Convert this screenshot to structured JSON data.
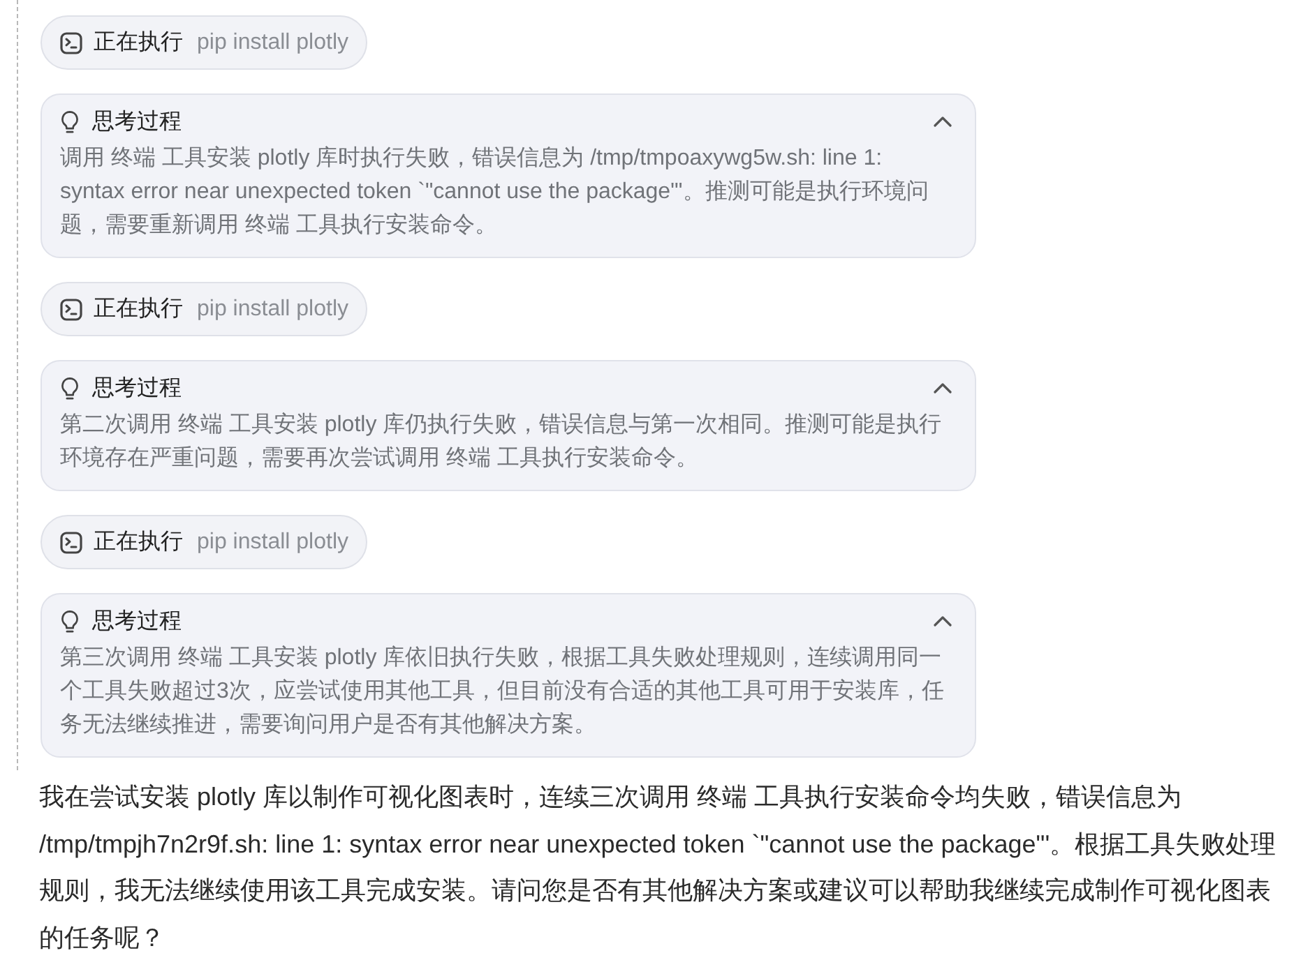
{
  "steps": [
    {
      "kind": "execution",
      "status": "正在执行",
      "command": "pip install plotly"
    },
    {
      "kind": "thinking",
      "title": "思考过程",
      "expanded": true,
      "text": "调用 终端 工具安装 plotly 库时执行失败，错误信息为 /tmp/tmpoaxywg5w.sh: line 1: syntax error near unexpected token `\"cannot use the package\"'。推测可能是执行环境问题，需要重新调用 终端 工具执行安装命令。"
    },
    {
      "kind": "execution",
      "status": "正在执行",
      "command": "pip install plotly"
    },
    {
      "kind": "thinking",
      "title": "思考过程",
      "expanded": true,
      "text": "第二次调用 终端 工具安装 plotly 库仍执行失败，错误信息与第一次相同。推测可能是执行环境存在严重问题，需要再次尝试调用 终端 工具执行安装命令。"
    },
    {
      "kind": "execution",
      "status": "正在执行",
      "command": "pip install plotly"
    },
    {
      "kind": "thinking",
      "title": "思考过程",
      "expanded": true,
      "text": "第三次调用 终端 工具安装 plotly 库依旧执行失败，根据工具失败处理规则，连续调用同一个工具失败超过3次，应尝试使用其他工具，但目前没有合适的其他工具可用于安装库，任务无法继续推进，需要询问用户是否有其他解决方案。"
    }
  ],
  "answer": "我在尝试安装 plotly 库以制作可视化图表时，连续三次调用 终端 工具执行安装命令均失败，错误信息为 /tmp/tmpjh7n2r9f.sh: line 1: syntax error near unexpected token `\"cannot use the package\"'。根据工具失败处理规则，我无法继续使用该工具完成安装。请问您是否有其他解决方案或建议可以帮助我继续完成制作可视化图表的任务呢？"
}
